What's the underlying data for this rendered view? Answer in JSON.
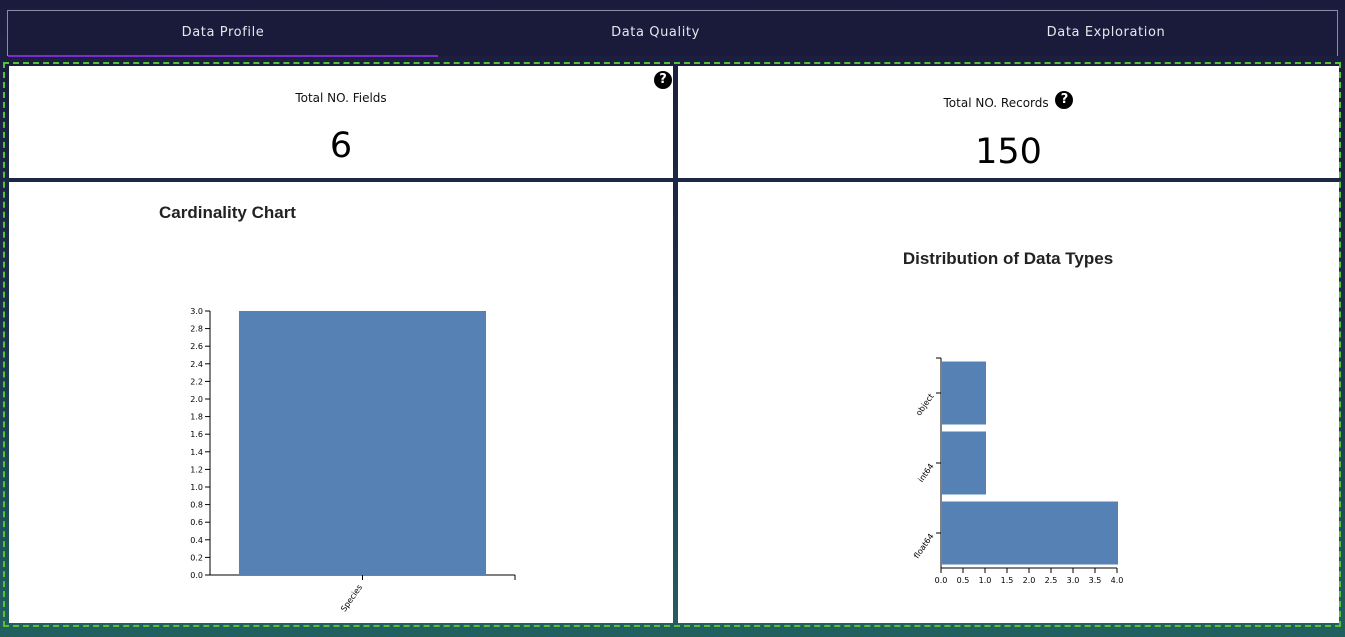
{
  "tabs": [
    {
      "label": "Data Profile"
    },
    {
      "label": "Data Quality"
    },
    {
      "label": "Data Exploration"
    }
  ],
  "active_tab": "Data Profile",
  "stats": {
    "fields": {
      "label": "Total NO. Fields",
      "value": "6"
    },
    "records": {
      "label": "Total NO. Records",
      "value": "150"
    }
  },
  "icons": {
    "help": "question-circle-icon"
  },
  "colors": {
    "bar": "#5681b4",
    "accent": "#7b2ccf",
    "frame": "#52c434"
  },
  "chart_data": [
    {
      "type": "bar",
      "title": "Cardinality Chart",
      "categories": [
        "Species"
      ],
      "values": [
        3
      ],
      "ylim": [
        0,
        3
      ],
      "yticks": [
        "0.0",
        "0.2",
        "0.4",
        "0.6",
        "0.8",
        "1.0",
        "1.2",
        "1.4",
        "1.6",
        "1.8",
        "2.0",
        "2.2",
        "2.4",
        "2.6",
        "2.8",
        "3.0"
      ],
      "xlabel": "",
      "ylabel": "",
      "grid": false
    },
    {
      "type": "bar",
      "orientation": "horizontal",
      "title": "Distribution of Data Types",
      "categories": [
        "object",
        "int64",
        "float64"
      ],
      "values": [
        1,
        1,
        4
      ],
      "xlim": [
        0,
        4
      ],
      "xticks": [
        "0.0",
        "0.5",
        "1.0",
        "1.5",
        "2.0",
        "2.5",
        "3.0",
        "3.5",
        "4.0"
      ],
      "xlabel": "",
      "ylabel": "",
      "grid": false
    }
  ]
}
